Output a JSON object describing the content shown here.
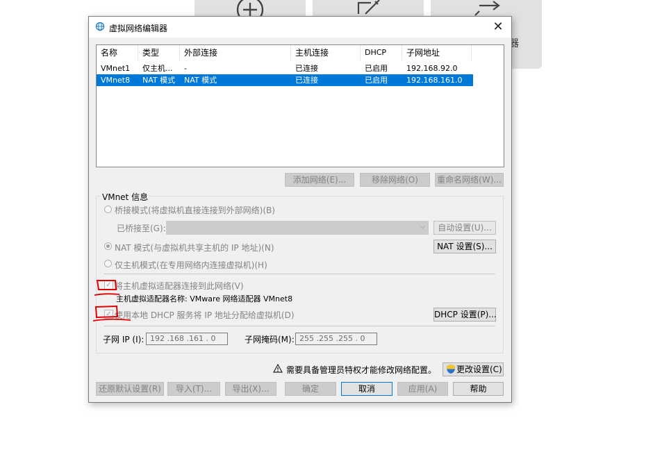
{
  "background": {
    "partial_label": "器"
  },
  "dialog": {
    "title": "虚拟网络编辑器",
    "close_glyph": "✕",
    "table": {
      "columns": [
        "名称",
        "类型",
        "外部连接",
        "主机连接",
        "DHCP",
        "子网地址"
      ],
      "rows": [
        {
          "name": "VMnet1",
          "type": "仅主机...",
          "external": "-",
          "host": "已连接",
          "dhcp": "已启用",
          "subnet": "192.168.92.0",
          "selected": false
        },
        {
          "name": "VMnet8",
          "type": "NAT 模式",
          "external": "NAT 模式",
          "host": "已连接",
          "dhcp": "已启用",
          "subnet": "192.168.161.0",
          "selected": true
        }
      ]
    },
    "network_buttons": {
      "add": "添加网络(E)...",
      "remove": "移除网络(O)",
      "rename": "重命名网络(W)..."
    },
    "vmnet_info": {
      "label": "VMnet 信息",
      "bridged_mode": "桥接模式(将虚拟机直接连接到外部网络)(B)",
      "bridged_to_label": "已桥接至(G):",
      "bridged_to_value": "",
      "auto_settings": "自动设置(U)...",
      "nat_mode": "NAT 模式(与虚拟机共享主机的 IP 地址)(N)",
      "nat_settings": "NAT 设置(S)...",
      "host_only_mode": "仅主机模式(在专用网络内连接虚拟机)(H)",
      "connect_adapter": "将主机虚拟适配器连接到此网络(V)",
      "adapter_name": "主机虚拟适配器名称: VMware 网络适配器 VMnet8",
      "use_dhcp": "使用本地 DHCP 服务将 IP 地址分配给虚拟机(D)",
      "dhcp_settings": "DHCP 设置(P)...",
      "subnet_ip_label": "子网 IP (I):",
      "subnet_ip_value": "192 .168 .161 .  0",
      "subnet_mask_label": "子网掩码(M):",
      "subnet_mask_value": "255 .255 .255 .  0",
      "selected_mode": "nat"
    },
    "admin_notice": "需要具备管理员特权才能修改网络配置。",
    "change_settings": "更改设置(C)",
    "footer_buttons": {
      "restore": "还原默认设置(R)",
      "import": "导入(T)...",
      "export": "导出(X)...",
      "ok": "确定",
      "cancel": "取消",
      "apply": "应用(A)",
      "help": "帮助"
    },
    "colors": {
      "selection": "#0078d7",
      "annotation": "#e00000",
      "dialog_bg": "#f0f0f0"
    }
  }
}
